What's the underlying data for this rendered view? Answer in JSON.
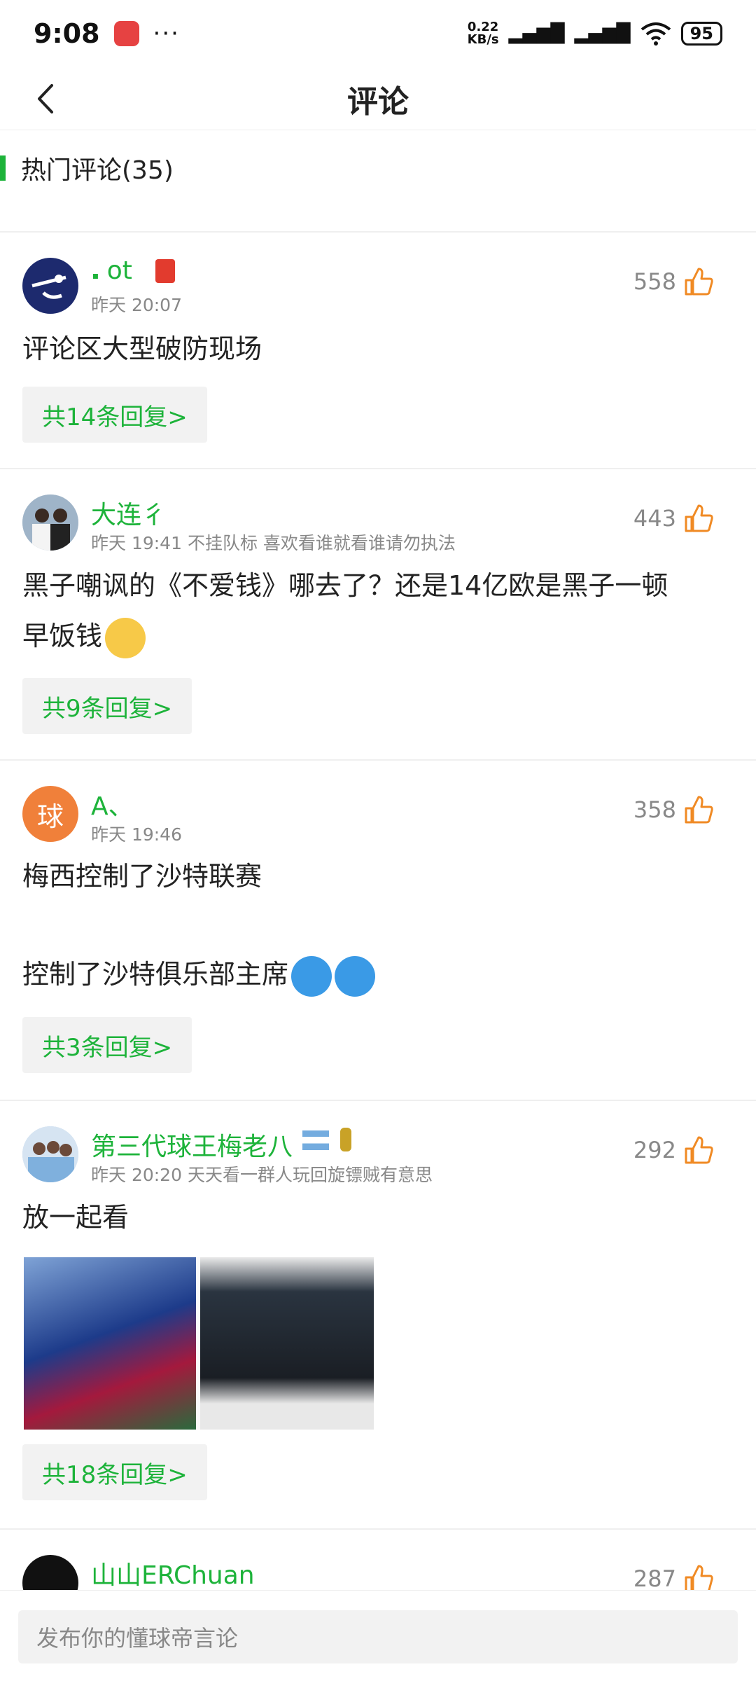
{
  "status": {
    "time": "9:08",
    "dots": "···",
    "speed_value": "0.22",
    "speed_unit": "KB/s",
    "battery": "95"
  },
  "header": {
    "title": "评论"
  },
  "section": {
    "title": "热门评论(35)"
  },
  "comments": [
    {
      "username": "𝅇 ot",
      "meta": "昨天 20:07",
      "likes": "558",
      "lines": [
        "评论区大型破防现场"
      ],
      "reply": "共14条回复>"
    },
    {
      "username": "大连彳",
      "meta": "昨天 19:41 不挂队标 喜欢看谁就看谁请勿执法",
      "likes": "443",
      "lines": [
        "黑子嘲讽的《不爱钱》哪去了？还是14亿欧是黑子一顿",
        "早饭钱"
      ],
      "reply": "共9条回复>"
    },
    {
      "username": "A、",
      "avatar_text": "球",
      "meta": "昨天 19:46",
      "likes": "358",
      "lines": [
        "梅西控制了沙特联赛",
        "",
        "控制了沙特俱乐部主席"
      ],
      "reply": "共3条回复>"
    },
    {
      "username": "第三代球王梅老八",
      "meta": "昨天 20:20 天天看一群人玩回旋镖贼有意思",
      "likes": "292",
      "lines": [
        "放一起看"
      ],
      "reply": "共18条回复>"
    },
    {
      "username": "山山ERChuan",
      "likes": "287"
    }
  ],
  "input": {
    "placeholder": "发布你的懂球帝言论"
  },
  "colors": {
    "accent": "#1db33a",
    "like": "#f08a24",
    "avatar_orange": "#f0803a"
  }
}
